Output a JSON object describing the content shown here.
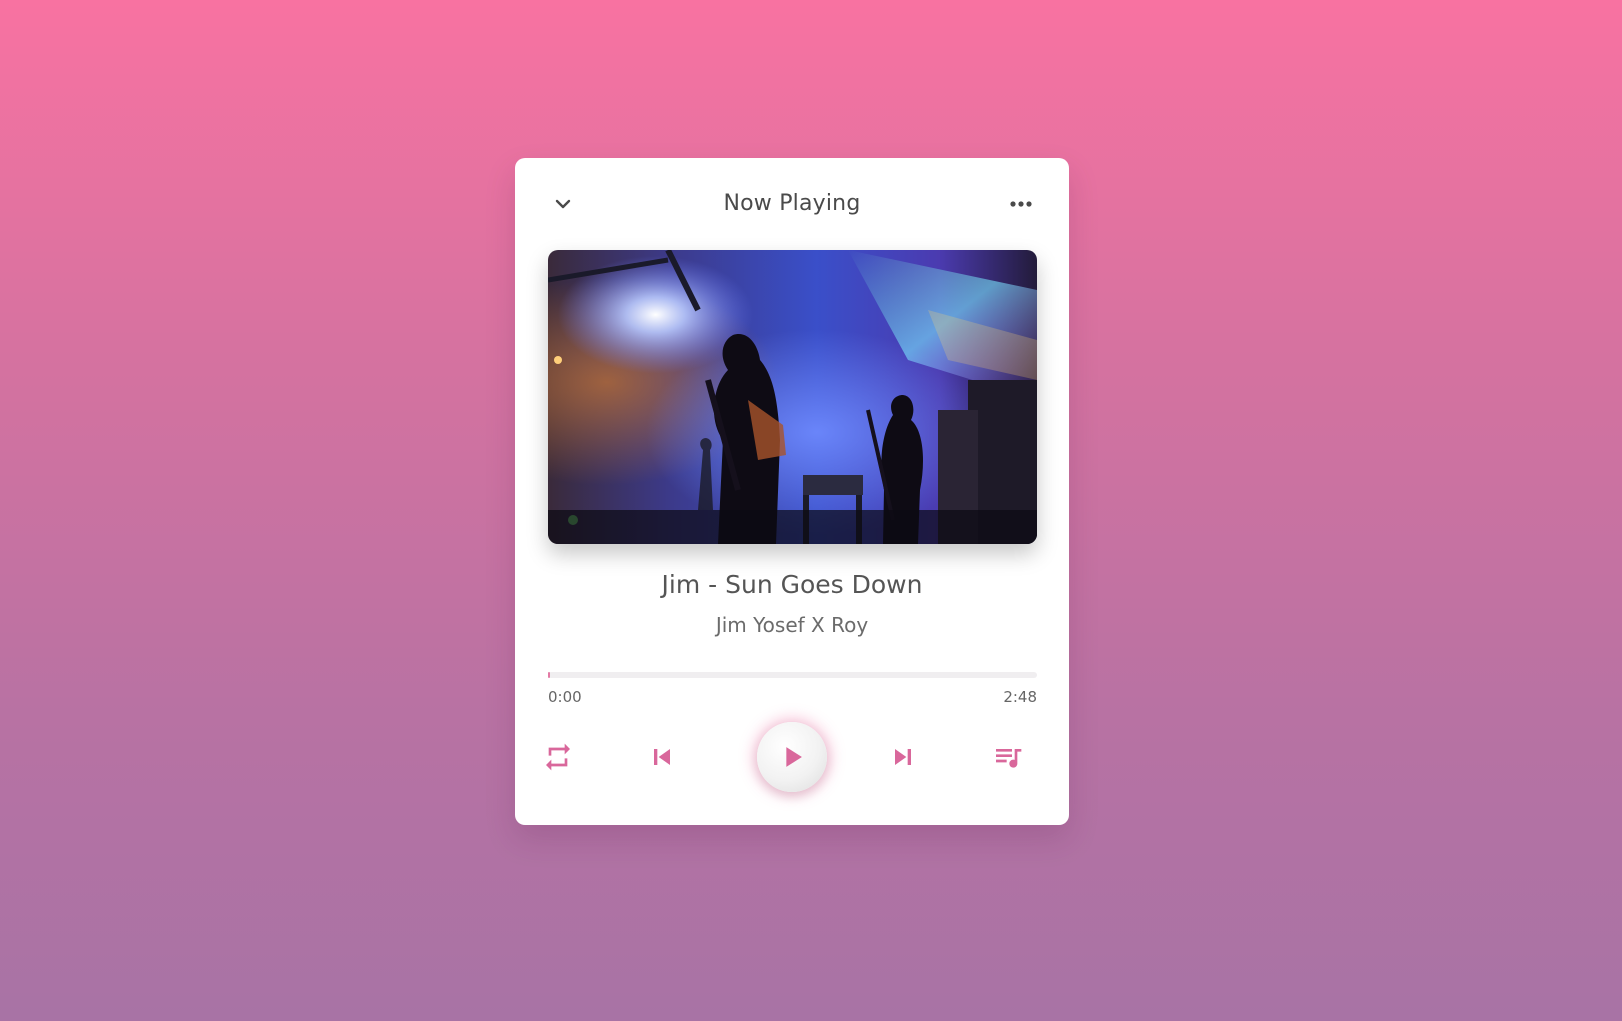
{
  "header": {
    "title": "Now Playing",
    "collapse_icon": "chevron-down-icon",
    "menu_icon": "more-horizontal-icon"
  },
  "album_art": {
    "description_icon": "concert-photo"
  },
  "track": {
    "title": "Jim - Sun Goes Down",
    "artist": "Jim Yosef X Roy"
  },
  "progress": {
    "current_time": "0:00",
    "duration": "2:48",
    "fraction": 0
  },
  "controls": {
    "repeat_icon": "repeat-icon",
    "previous_icon": "skip-previous-icon",
    "play_icon": "play-icon",
    "next_icon": "skip-next-icon",
    "queue_icon": "queue-music-icon"
  },
  "colors": {
    "accent": "#d9679b",
    "background_top": "#f872a1",
    "background_bottom": "#a873a5",
    "card": "#ffffff"
  }
}
